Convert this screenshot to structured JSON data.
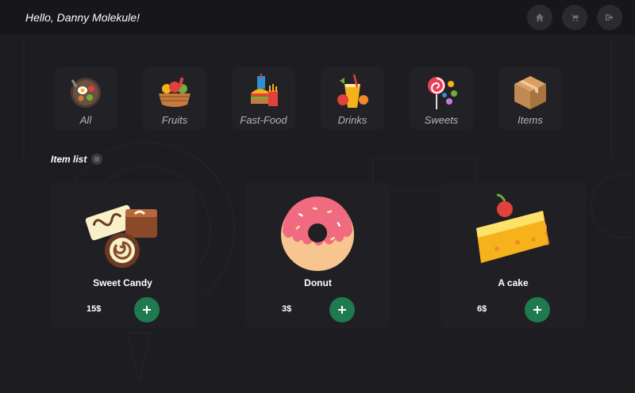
{
  "header": {
    "greeting": "Hello, Danny Molekule!",
    "nav": [
      {
        "icon": "home-icon"
      },
      {
        "icon": "cart-icon"
      },
      {
        "icon": "logout-icon"
      }
    ]
  },
  "categories": [
    {
      "label": "All",
      "icon": "all-food-icon"
    },
    {
      "label": "Fruits",
      "icon": "fruits-icon"
    },
    {
      "label": "Fast-Food",
      "icon": "fast-food-icon"
    },
    {
      "label": "Drinks",
      "icon": "drinks-icon"
    },
    {
      "label": "Sweets",
      "icon": "sweets-icon"
    },
    {
      "label": "Items",
      "icon": "box-icon"
    }
  ],
  "item_list": {
    "title": "Item list",
    "items": [
      {
        "name": "Sweet Candy",
        "price": "15$",
        "icon": "candy-icon"
      },
      {
        "name": "Donut",
        "price": "3$",
        "icon": "donut-icon"
      },
      {
        "name": "A cake",
        "price": "6$",
        "icon": "cake-icon"
      }
    ]
  },
  "colors": {
    "background": "#1c1c21",
    "card": "#202024",
    "accent_green": "#1f7a4f"
  }
}
